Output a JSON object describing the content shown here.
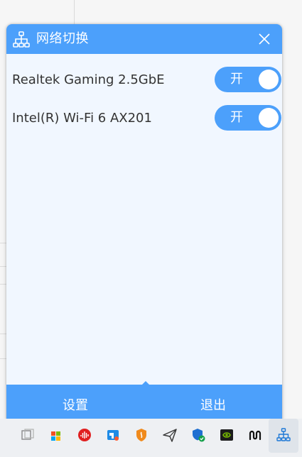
{
  "window": {
    "title": "网络切换",
    "close_icon": "close-icon",
    "app_icon": "network-tree-icon"
  },
  "adapters": [
    {
      "name": "Realtek Gaming 2.5GbE",
      "toggle_label": "开",
      "enabled": true
    },
    {
      "name": "Intel(R) Wi-Fi 6 AX201",
      "toggle_label": "开",
      "enabled": true
    }
  ],
  "footer": {
    "settings_label": "设置",
    "exit_label": "退出"
  },
  "taskbar": {
    "icons": [
      "task-view-icon",
      "microsoft-store-icon",
      "audio-app-icon",
      "tencent-app-icon",
      "firewall-shield-icon",
      "send-arrow-icon",
      "defender-shield-icon",
      "nvidia-icon",
      "notion-like-icon",
      "network-tree-icon"
    ]
  },
  "colors": {
    "accent": "#4ca0fb",
    "panel_bg": "#f1f7ff",
    "text": "#333333"
  }
}
